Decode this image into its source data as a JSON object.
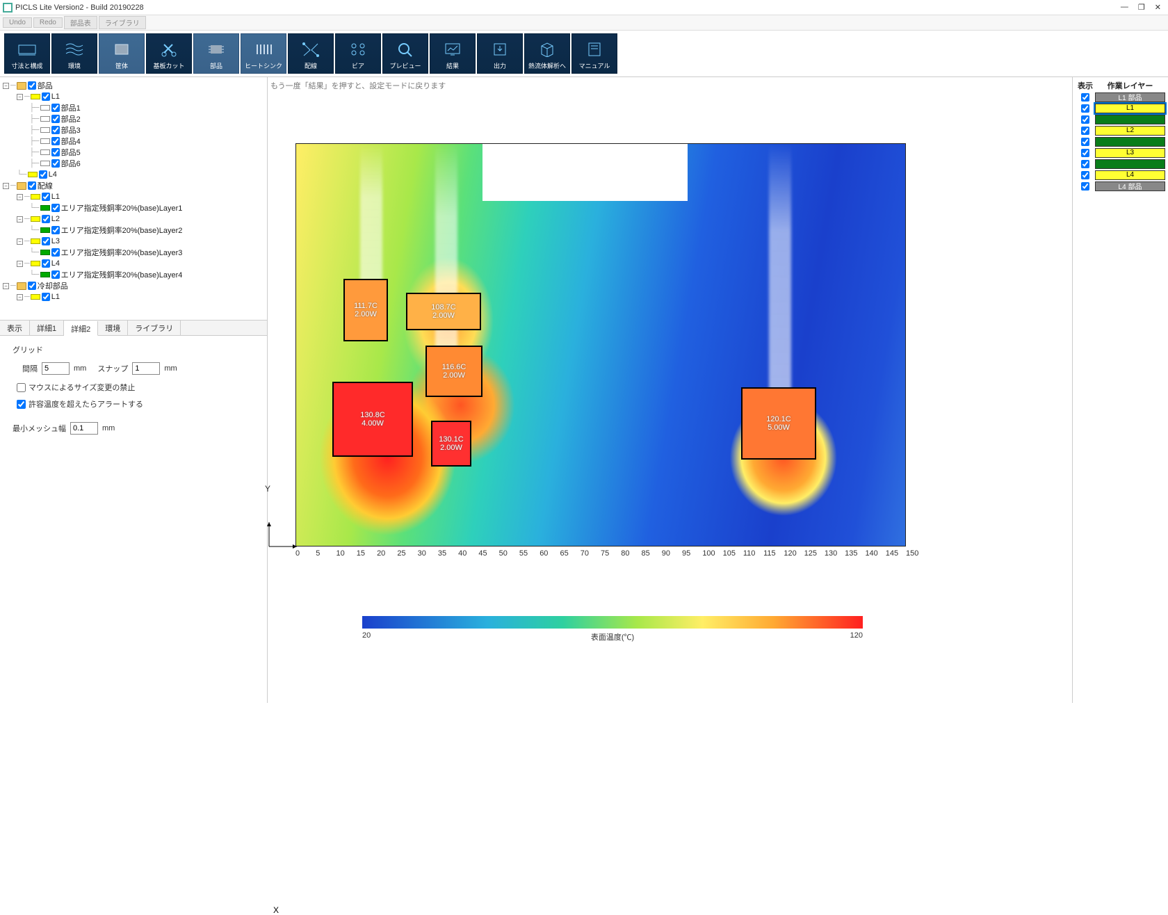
{
  "window": {
    "title": "PICLS Lite Version2 - Build 20190228"
  },
  "menubar": {
    "undo": "Undo",
    "redo": "Redo",
    "parts": "部品表",
    "library": "ライブラリ"
  },
  "toolbar": [
    {
      "id": "dims",
      "label": "寸法と構成"
    },
    {
      "id": "env",
      "label": "環境"
    },
    {
      "id": "body",
      "label": "筐体"
    },
    {
      "id": "cut",
      "label": "基板カット"
    },
    {
      "id": "part",
      "label": "部品"
    },
    {
      "id": "hs",
      "label": "ヒートシンク"
    },
    {
      "id": "wire",
      "label": "配線"
    },
    {
      "id": "via",
      "label": "ビア"
    },
    {
      "id": "prev",
      "label": "プレビュー"
    },
    {
      "id": "result",
      "label": "結果"
    },
    {
      "id": "out",
      "label": "出力"
    },
    {
      "id": "cfd",
      "label": "熱流体解析へ"
    },
    {
      "id": "man",
      "label": "マニュアル"
    }
  ],
  "tree": {
    "root_parts": "部品",
    "L1": "L1",
    "L4": "L4",
    "parts": [
      "部品1",
      "部品2",
      "部品3",
      "部品4",
      "部品5",
      "部品6"
    ],
    "wiring": "配線",
    "layers": [
      "L1",
      "L2",
      "L3",
      "L4"
    ],
    "layer_detail": "エリア指定残銅率20%(base)Layer",
    "cooling": "冷却部品"
  },
  "detail_tabs": [
    "表示",
    "詳細1",
    "詳細2",
    "環境",
    "ライブラリ"
  ],
  "detail": {
    "grid": "グリッド",
    "interval_label": "間隔",
    "interval_value": "5",
    "interval_unit": "mm",
    "snap_label": "スナップ",
    "snap_value": "1",
    "snap_unit": "mm",
    "cb1": "マウスによるサイズ変更の禁止",
    "cb2": "許容温度を超えたらアラートする",
    "mesh_label": "最小メッシュ幅",
    "mesh_value": "0.1",
    "mesh_unit": "mm"
  },
  "hint": "もう一度「結果」を押すと、設定モードに戻ります",
  "chart_data": {
    "type": "heatmap",
    "title": "",
    "xlabel": "X",
    "ylabel": "Y",
    "xlim": [
      0,
      150
    ],
    "xticks": [
      0,
      5,
      10,
      15,
      20,
      25,
      30,
      35,
      40,
      45,
      50,
      55,
      60,
      65,
      70,
      75,
      80,
      85,
      90,
      95,
      100,
      105,
      110,
      115,
      120,
      125,
      130,
      135,
      140,
      145,
      150
    ],
    "colorbar": {
      "label": "表面温度(℃)",
      "min": 20,
      "max": 120
    },
    "components": [
      {
        "name": "部品1",
        "temp_c": 111.7,
        "power_w": 2.0
      },
      {
        "name": "部品2",
        "temp_c": 108.7,
        "power_w": 2.0
      },
      {
        "name": "部品3",
        "temp_c": 116.6,
        "power_w": 2.0
      },
      {
        "name": "部品4",
        "temp_c": 130.8,
        "power_w": 4.0
      },
      {
        "name": "部品5",
        "temp_c": 130.1,
        "power_w": 2.0
      },
      {
        "name": "部品6",
        "temp_c": 120.1,
        "power_w": 5.0
      }
    ]
  },
  "comp_text": {
    "c1a": "111.7C",
    "c1b": "2.00W",
    "c2a": "108.7C",
    "c2b": "2.00W",
    "c3a": "116.6C",
    "c3b": "2.00W",
    "c4a": "130.8C",
    "c4b": "4.00W",
    "c5a": "130.1C",
    "c5b": "2.00W",
    "c6a": "120.1C",
    "c6b": "5.00W"
  },
  "cb_labels": {
    "min": "20",
    "mid": "表面温度(℃)",
    "max": "120"
  },
  "right": {
    "hdr1": "表示",
    "hdr2": "作業レイヤー",
    "rows": [
      {
        "label": "L1 部品",
        "cls": "gray"
      },
      {
        "label": "L1",
        "cls": "yel sel"
      },
      {
        "label": "",
        "cls": "grn"
      },
      {
        "label": "L2",
        "cls": "yel"
      },
      {
        "label": "",
        "cls": "grn"
      },
      {
        "label": "L3",
        "cls": "yel"
      },
      {
        "label": "",
        "cls": "grn"
      },
      {
        "label": "L4",
        "cls": "yel"
      },
      {
        "label": "L4 部品",
        "cls": "gray"
      }
    ]
  }
}
